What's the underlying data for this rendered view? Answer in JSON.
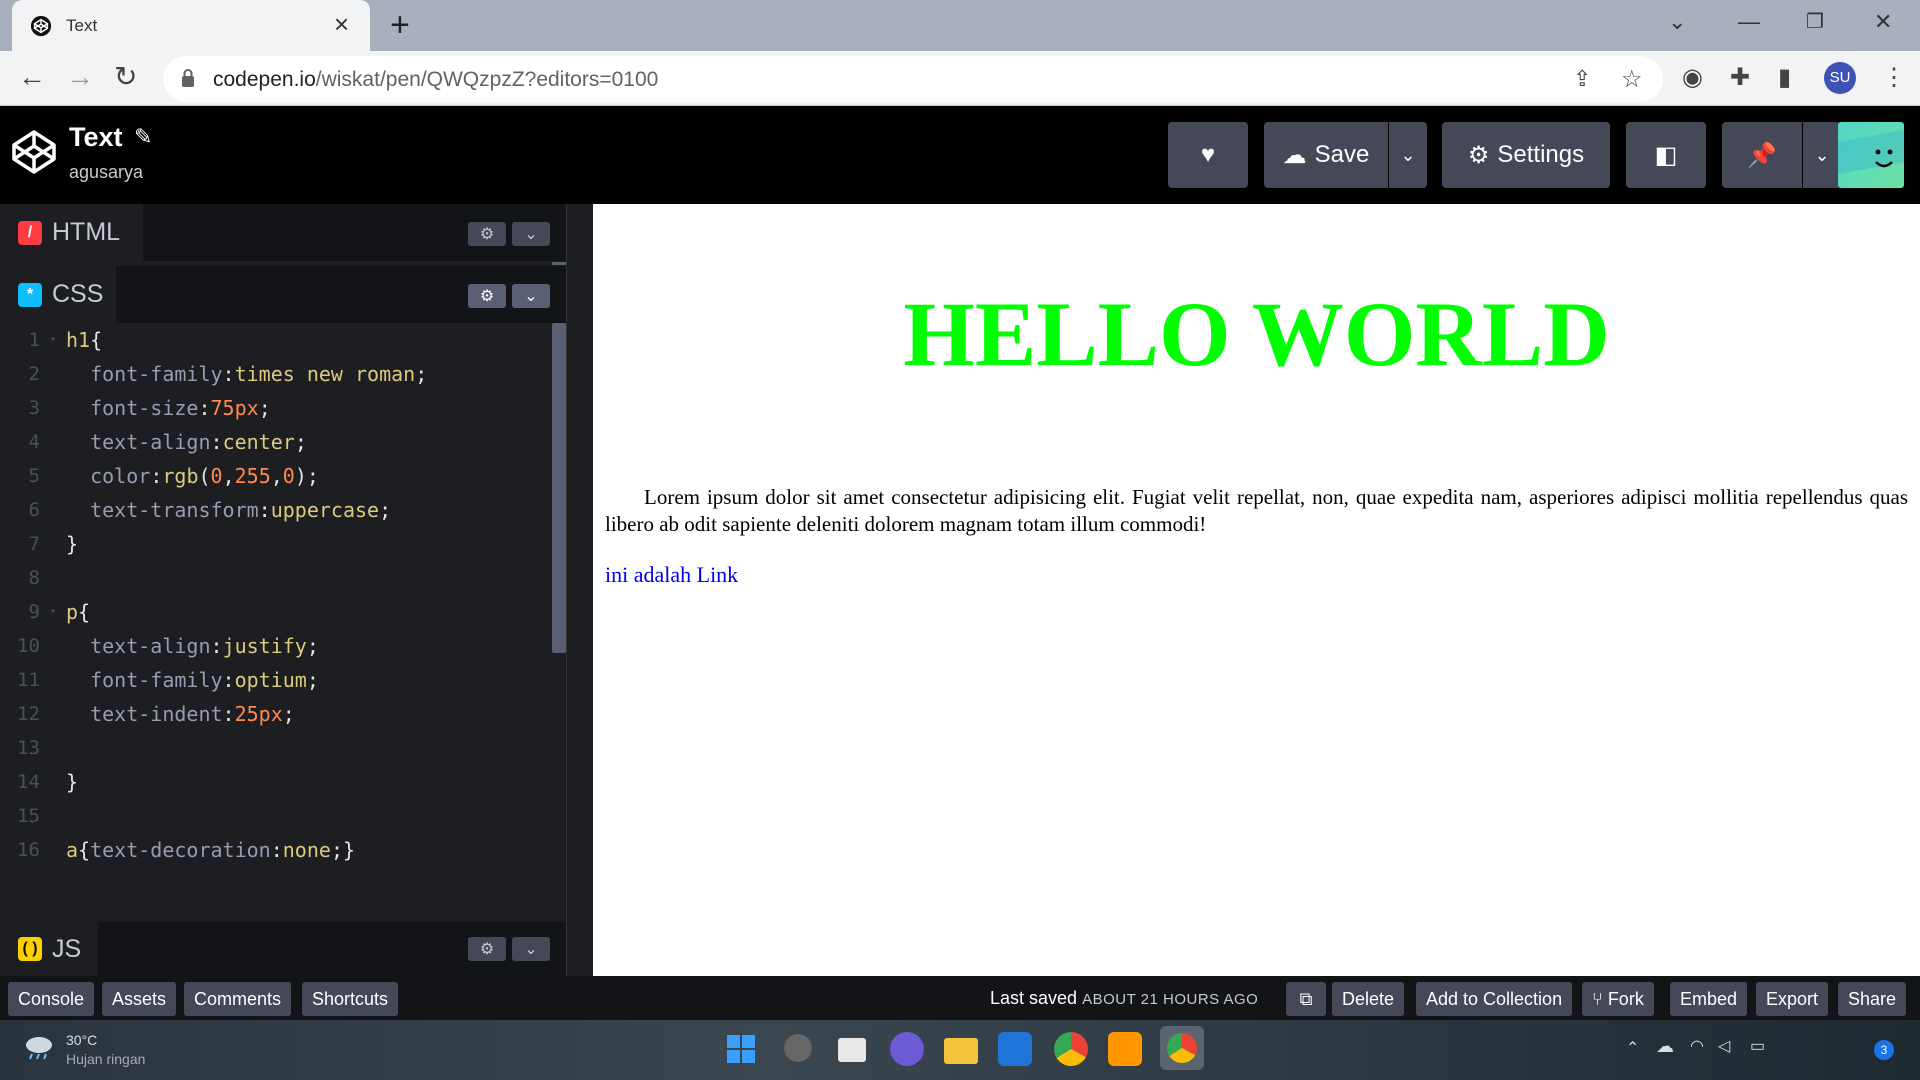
{
  "browser": {
    "tab_title": "Text",
    "url_host": "codepen.io",
    "url_path": "/wiskat/pen/QWQzpzZ?editors=0100",
    "profile_initials": "SU"
  },
  "header": {
    "pen_title": "Text",
    "user": "agusarya",
    "save_label": "Save",
    "settings_label": "Settings"
  },
  "editors": {
    "html_label": "HTML",
    "css_label": "CSS",
    "js_label": "JS"
  },
  "code_lines": [
    {
      "n": "1",
      "parts": [
        [
          "sel",
          "h1"
        ],
        [
          "punc",
          "{"
        ]
      ]
    },
    {
      "n": "2",
      "parts": [
        [
          "sp",
          "  "
        ],
        [
          "prop",
          "font-family"
        ],
        [
          "punc",
          ":"
        ],
        [
          "val",
          "times new roman"
        ],
        [
          "punc",
          ";"
        ]
      ]
    },
    {
      "n": "3",
      "parts": [
        [
          "sp",
          "  "
        ],
        [
          "prop",
          "font-size"
        ],
        [
          "punc",
          ":"
        ],
        [
          "num",
          "75px"
        ],
        [
          "punc",
          ";"
        ]
      ]
    },
    {
      "n": "4",
      "parts": [
        [
          "sp",
          "  "
        ],
        [
          "prop",
          "text-align"
        ],
        [
          "punc",
          ":"
        ],
        [
          "val",
          "center"
        ],
        [
          "punc",
          ";"
        ]
      ]
    },
    {
      "n": "5",
      "parts": [
        [
          "sp",
          "  "
        ],
        [
          "prop",
          "color"
        ],
        [
          "punc",
          ":"
        ],
        [
          "val",
          "rgb"
        ],
        [
          "punc",
          "("
        ],
        [
          "num",
          "0"
        ],
        [
          "punc",
          ","
        ],
        [
          "num",
          "255"
        ],
        [
          "punc",
          ","
        ],
        [
          "num",
          "0"
        ],
        [
          "punc",
          ");"
        ]
      ]
    },
    {
      "n": "6",
      "parts": [
        [
          "sp",
          "  "
        ],
        [
          "prop",
          "text-transform"
        ],
        [
          "punc",
          ":"
        ],
        [
          "val",
          "uppercase"
        ],
        [
          "punc",
          ";"
        ]
      ]
    },
    {
      "n": "7",
      "parts": [
        [
          "punc",
          "}"
        ]
      ]
    },
    {
      "n": "8",
      "parts": []
    },
    {
      "n": "9",
      "parts": [
        [
          "sel",
          "p"
        ],
        [
          "punc",
          "{"
        ]
      ]
    },
    {
      "n": "10",
      "parts": [
        [
          "sp",
          "  "
        ],
        [
          "prop",
          "text-align"
        ],
        [
          "punc",
          ":"
        ],
        [
          "val",
          "justify"
        ],
        [
          "punc",
          ";"
        ]
      ]
    },
    {
      "n": "11",
      "parts": [
        [
          "sp",
          "  "
        ],
        [
          "prop",
          "font-family"
        ],
        [
          "punc",
          ":"
        ],
        [
          "val",
          "optium"
        ],
        [
          "punc",
          ";"
        ]
      ]
    },
    {
      "n": "12",
      "parts": [
        [
          "sp",
          "  "
        ],
        [
          "prop",
          "text-indent"
        ],
        [
          "punc",
          ":"
        ],
        [
          "num",
          "25px"
        ],
        [
          "punc",
          ";"
        ]
      ]
    },
    {
      "n": "13",
      "parts": []
    },
    {
      "n": "14",
      "parts": [
        [
          "punc",
          "}"
        ]
      ]
    },
    {
      "n": "15",
      "parts": []
    },
    {
      "n": "16",
      "parts": [
        [
          "sel",
          "a"
        ],
        [
          "punc",
          "{"
        ],
        [
          "prop",
          "text-decoration"
        ],
        [
          "punc",
          ":"
        ],
        [
          "val",
          "none"
        ],
        [
          "punc",
          ";}"
        ]
      ]
    }
  ],
  "preview": {
    "heading": "Hello World",
    "paragraph": "Lorem ipsum dolor sit amet consectetur adipisicing elit. Fugiat velit repellat, non, quae expedita nam, asperiores adipisci mollitia repellendus quas libero ab odit sapiente deleniti dolorem magnam totam illum commodi!",
    "link": "ini adalah Link"
  },
  "footer": {
    "console": "Console",
    "assets": "Assets",
    "comments": "Comments",
    "shortcuts": "Shortcuts",
    "last_saved": "Last saved",
    "last_saved_time": "ABOUT 21 HOURS AGO",
    "delete": "Delete",
    "add_to_collection": "Add to Collection",
    "fork": "Fork",
    "embed": "Embed",
    "export": "Export",
    "share": "Share"
  },
  "taskbar": {
    "temperature": "30°C",
    "condition": "Hujan ringan",
    "notification_count": "3"
  },
  "colors": {
    "codepen_bg": "#010101",
    "editor_bg": "#1d1e22",
    "button_bg": "#444857",
    "heading_green": "#00ff00",
    "link_blue": "#0000ee"
  }
}
